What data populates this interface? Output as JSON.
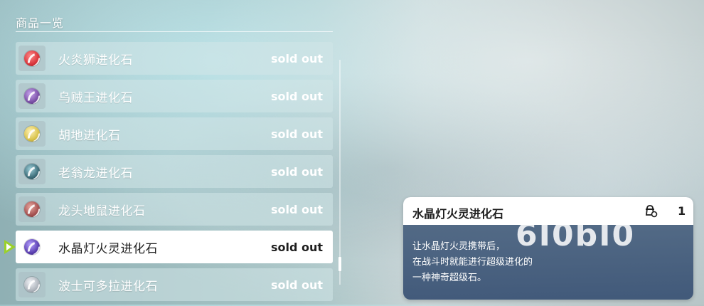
{
  "header": {
    "title": "商品一览"
  },
  "items": [
    {
      "name": "火炎狮进化石",
      "status": "sold out",
      "stone_color": "#d8343a",
      "selected": false
    },
    {
      "name": "乌贼王进化石",
      "status": "sold out",
      "stone_color": "#7a4fa6",
      "selected": false
    },
    {
      "name": "胡地进化石",
      "status": "sold out",
      "stone_color": "#d8c24a",
      "selected": false
    },
    {
      "name": "老翁龙进化石",
      "status": "sold out",
      "stone_color": "#3c6c78",
      "selected": false
    },
    {
      "name": "龙头地鼠进化石",
      "status": "sold out",
      "stone_color": "#a45050",
      "selected": false
    },
    {
      "name": "水晶灯火灵进化石",
      "status": "sold out",
      "stone_color": "#5a3fb0",
      "selected": true
    },
    {
      "name": "波士可多拉进化石",
      "status": "sold out",
      "stone_color": "#aeb4bc",
      "selected": false
    }
  ],
  "detail": {
    "name": "水晶灯火灵进化石",
    "bag_icon": "bag-icon",
    "quantity": "1",
    "watermark": "6I0bI0",
    "description": [
      "让水晶灯火灵携带后，",
      "在战斗时就能进行超级进化的",
      "一种神奇超级石。"
    ]
  },
  "colors": {
    "cursor": "#9bd12a",
    "selected_row": "#ffffff",
    "detail_bg": "#3f5878"
  }
}
